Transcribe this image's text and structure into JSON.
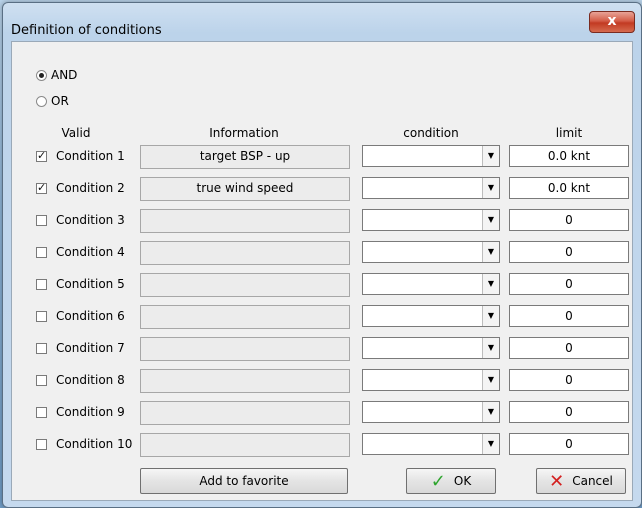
{
  "window": {
    "title": "Definition of conditions",
    "close_label": "x"
  },
  "logic": [
    {
      "label": "AND",
      "selected": true
    },
    {
      "label": "OR",
      "selected": false
    }
  ],
  "headers": {
    "valid": "Valid",
    "information": "Information",
    "condition": "condition",
    "limit": "limit"
  },
  "rows": [
    {
      "label": "Condition 1",
      "checked": true,
      "information": "target BSP - up",
      "condition": "",
      "limit": "0.0 knt"
    },
    {
      "label": "Condition 2",
      "checked": true,
      "information": "true wind speed",
      "condition": "",
      "limit": "0.0 knt"
    },
    {
      "label": "Condition 3",
      "checked": false,
      "information": "",
      "condition": "",
      "limit": "0"
    },
    {
      "label": "Condition 4",
      "checked": false,
      "information": "",
      "condition": "",
      "limit": "0"
    },
    {
      "label": "Condition 5",
      "checked": false,
      "information": "",
      "condition": "",
      "limit": "0"
    },
    {
      "label": "Condition 6",
      "checked": false,
      "information": "",
      "condition": "",
      "limit": "0"
    },
    {
      "label": "Condition 7",
      "checked": false,
      "information": "",
      "condition": "",
      "limit": "0"
    },
    {
      "label": "Condition 8",
      "checked": false,
      "information": "",
      "condition": "",
      "limit": "0"
    },
    {
      "label": "Condition 9",
      "checked": false,
      "information": "",
      "condition": "",
      "limit": "0"
    },
    {
      "label": "Condition 10",
      "checked": false,
      "information": "",
      "condition": "",
      "limit": "0"
    }
  ],
  "buttons": {
    "favorite": "Add to favorite",
    "ok": "OK",
    "cancel": "Cancel"
  },
  "icons": {
    "ok": "checkmark-icon",
    "cancel": "cross-icon",
    "dropdown": "chevron-down-icon"
  }
}
